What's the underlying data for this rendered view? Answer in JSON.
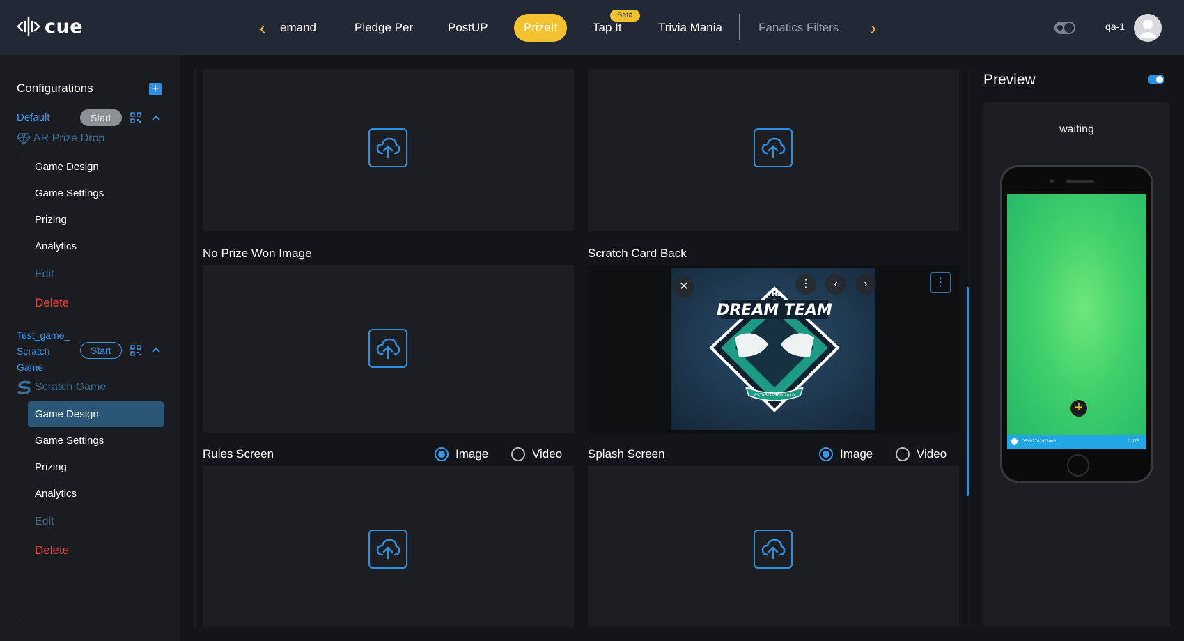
{
  "brand": {
    "name": "cue"
  },
  "nav": {
    "tabs": [
      {
        "label": "emand"
      },
      {
        "label": "Pledge Per"
      },
      {
        "label": "PostUP"
      },
      {
        "label": "PrizeIt"
      },
      {
        "label": "Tap It"
      },
      {
        "label": "Trivia Mania"
      },
      {
        "label": "Fanatics Filters"
      }
    ],
    "active_tab": "PrizeIt",
    "beta_badge": "Beta"
  },
  "user": {
    "name": "qa-1"
  },
  "sidebar": {
    "title": "Configurations",
    "configs": [
      {
        "name": "Default",
        "start_label": "Start",
        "game_type": "AR Prize Drop",
        "items": [
          {
            "label": "Game Design"
          },
          {
            "label": "Game Settings"
          },
          {
            "label": "Prizing"
          },
          {
            "label": "Analytics"
          },
          {
            "label": "Edit"
          },
          {
            "label": "Delete"
          }
        ]
      },
      {
        "name_lines": [
          "Test_game_",
          "Scratch",
          "Game"
        ],
        "start_label": "Start",
        "game_type": "Scratch Game",
        "items": [
          {
            "label": "Game Design"
          },
          {
            "label": "Game Settings"
          },
          {
            "label": "Prizing"
          },
          {
            "label": "Analytics"
          },
          {
            "label": "Edit"
          },
          {
            "label": "Delete"
          }
        ]
      }
    ]
  },
  "main": {
    "slots": [
      {
        "label": "No Prize Won Image"
      },
      {
        "label": "Scratch Card Back"
      },
      {
        "label": "Rules Screen",
        "options": [
          "Image",
          "Video"
        ],
        "selected": "Image"
      },
      {
        "label": "Splash Screen",
        "options": [
          "Image",
          "Video"
        ],
        "selected": "Image"
      }
    ],
    "scratch_back_image": {
      "text_small": "THE",
      "text_main": "DREAM TEAM",
      "text_ribbon": "ESTABLISHED 2010"
    }
  },
  "preview": {
    "title": "Preview",
    "status": "waiting",
    "phone_bar_left": "DEV07741971009...",
    "phone_bar_right": "0 PTS"
  },
  "colors": {
    "accent": "#2f8fe0",
    "highlight": "#f2c230",
    "danger": "#e8413d",
    "topbar": "#222836"
  }
}
